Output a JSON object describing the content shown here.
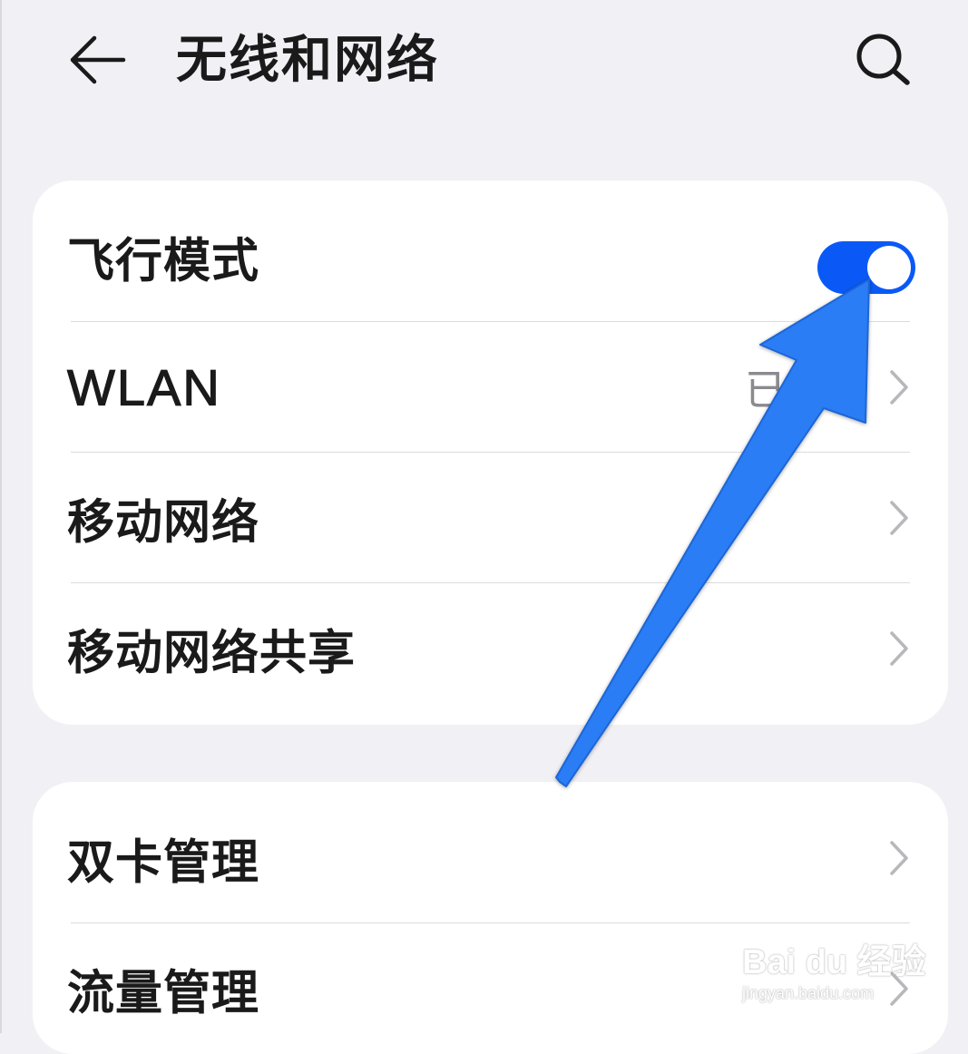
{
  "header": {
    "title": "无线和网络",
    "back_icon": "back-arrow-icon",
    "search_icon": "search-icon"
  },
  "card1": {
    "rows": [
      {
        "label": "飞行模式",
        "control": "toggle",
        "toggle_on": true
      },
      {
        "label": "WLAN",
        "value": "已关闭"
      },
      {
        "label": "移动网络"
      },
      {
        "label": "移动网络共享"
      }
    ]
  },
  "card2": {
    "rows": [
      {
        "label": "双卡管理"
      },
      {
        "label": "流量管理"
      }
    ]
  },
  "colors": {
    "background": "#f1f0f5",
    "card": "#ffffff",
    "toggle_on": "#0a59f7",
    "annotation_arrow": "#2a7df4",
    "secondary_text": "#8a8a8f"
  },
  "watermark": {
    "brand": "Bai du 经验",
    "url": "jingyan.baidu.com"
  }
}
